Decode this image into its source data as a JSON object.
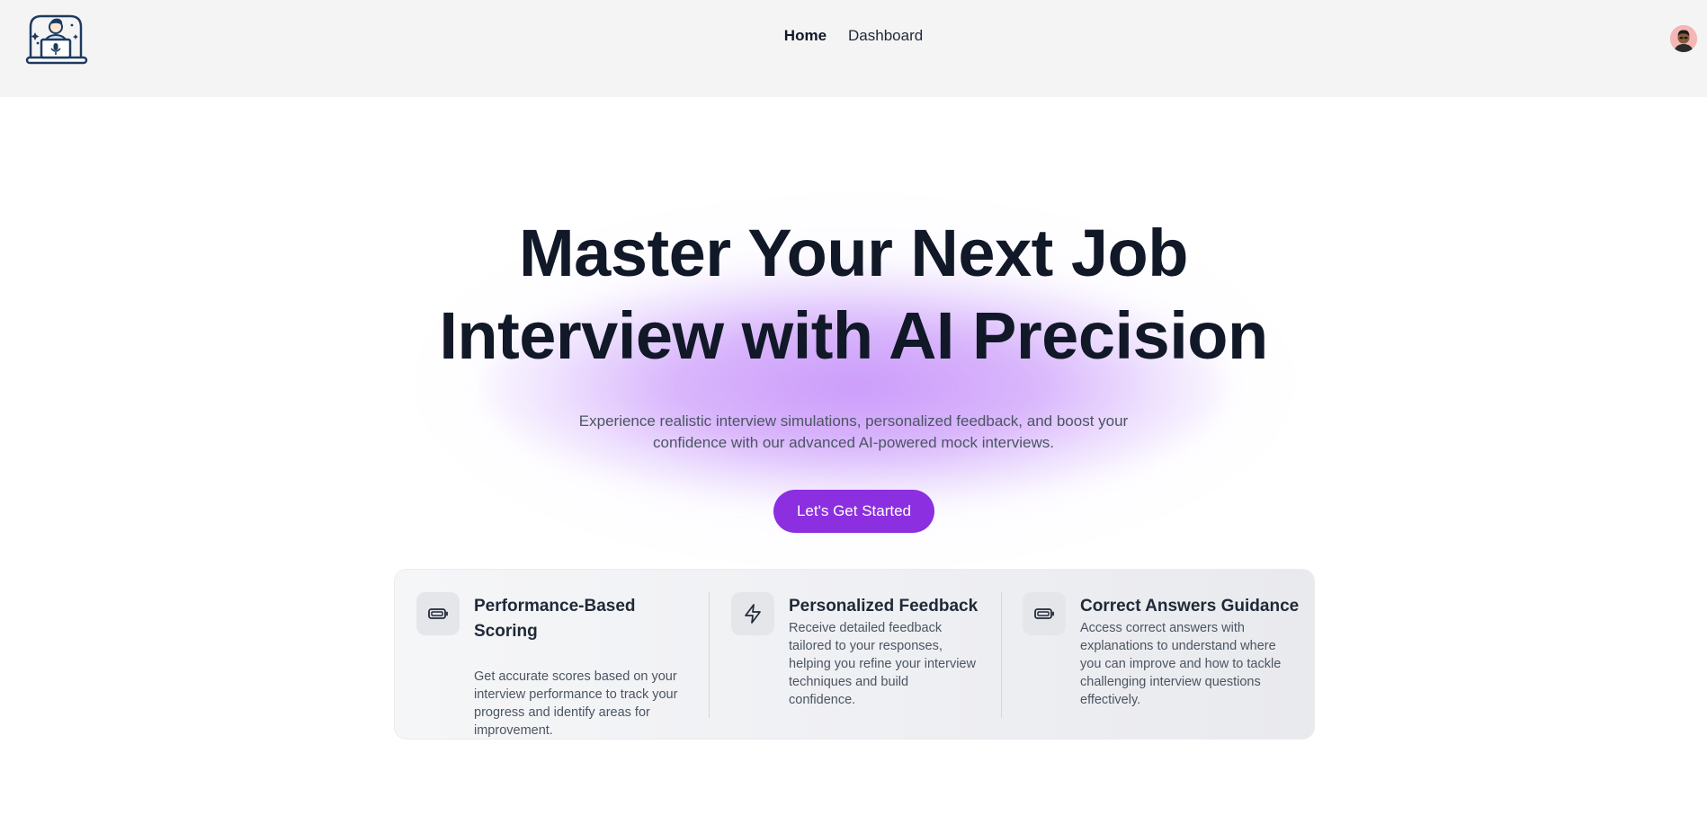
{
  "header": {
    "logo_icon": "interview-avatar-logo-icon",
    "nav": [
      {
        "label": "Home",
        "active": true
      },
      {
        "label": "Dashboard",
        "active": false
      }
    ],
    "avatar_icon": "user-avatar-icon"
  },
  "hero": {
    "title_line1": "Master Your Next Job",
    "title_line2": "Interview with AI Precision",
    "subtitle": "Experience realistic interview simulations, personalized feedback, and boost your confidence with our advanced AI-powered mock interviews.",
    "cta_label": "Let's Get Started",
    "accent_color": "#8b2fe0"
  },
  "features": [
    {
      "icon": "battery-icon",
      "title": "Performance-Based Scoring",
      "description": "Get accurate scores based on your interview performance to track your progress and identify areas for improvement."
    },
    {
      "icon": "lightning-icon",
      "title": "Personalized Feedback",
      "description": "Receive detailed feedback tailored to your responses, helping you refine your interview techniques and build confidence."
    },
    {
      "icon": "battery-icon",
      "title": "Correct Answers Guidance",
      "description": "Access correct answers with explanations to understand where you can improve and how to tackle challenging interview questions effectively."
    }
  ]
}
